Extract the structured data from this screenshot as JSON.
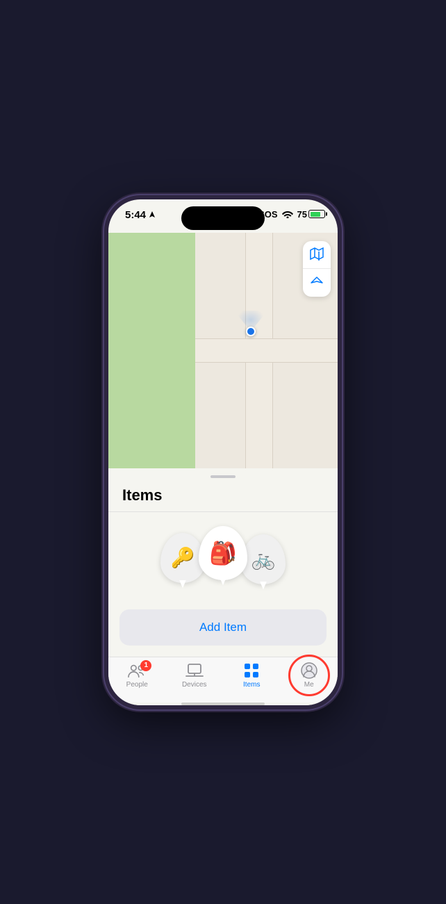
{
  "status_bar": {
    "time": "5:44",
    "sos": "SOS",
    "battery_percent": "75"
  },
  "map": {
    "controls": {
      "map_icon_label": "map",
      "location_icon_label": "location"
    }
  },
  "sheet": {
    "title": "Items",
    "handle_label": "drag handle"
  },
  "items": [
    {
      "emoji": "🔑",
      "label": "key"
    },
    {
      "emoji": "🎒",
      "label": "backpack"
    },
    {
      "emoji": "🚲",
      "label": "bicycle"
    }
  ],
  "add_item_button": {
    "label": "Add Item"
  },
  "tab_bar": {
    "tabs": [
      {
        "id": "people",
        "label": "People",
        "active": false,
        "badge": "1"
      },
      {
        "id": "devices",
        "label": "Devices",
        "active": false,
        "badge": null
      },
      {
        "id": "items",
        "label": "Items",
        "active": true,
        "badge": null
      },
      {
        "id": "me",
        "label": "Me",
        "active": false,
        "badge": null,
        "highlighted": true
      }
    ]
  }
}
